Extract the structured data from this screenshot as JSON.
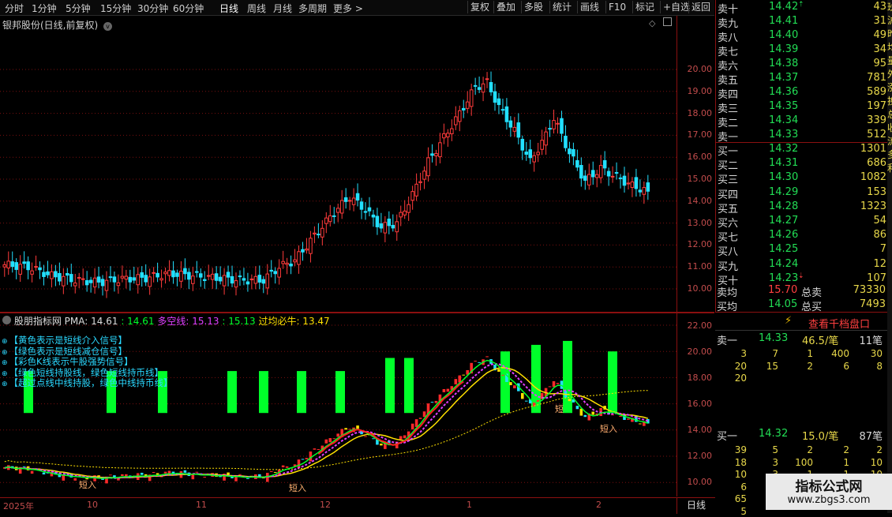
{
  "toolbar": {
    "periods": [
      "分时",
      "1分钟",
      "5分钟",
      "15分钟",
      "30分钟",
      "60分钟",
      "日线",
      "周线",
      "月线",
      "多周期",
      "更多 >"
    ],
    "active_period": "日线",
    "buttons": [
      "复权",
      "叠加",
      "多股",
      "统计",
      "画线",
      "F10",
      "标记",
      "+自选",
      "返回"
    ]
  },
  "stock": {
    "title": "银邦股份(日线,前复权)"
  },
  "price_axis": [
    "20.00",
    "19.00",
    "18.00",
    "17.00",
    "16.00",
    "15.00",
    "14.00",
    "13.00",
    "12.00",
    "11.00",
    "10.00"
  ],
  "indicator_axis": [
    "22.00",
    "20.00",
    "18.00",
    "16.00",
    "14.00",
    "12.00",
    "10.00"
  ],
  "indicator": {
    "name": "股朋指标网",
    "pma_label": "PMA: 14.61",
    "v1": ": 14.61",
    "duokong_label": "多空线: 15.13",
    "v2": ": 15.13",
    "guojun_label": "过均必牛: 13.47",
    "legend": [
      "【黄色表示是短线介入信号】",
      "【绿色表示是短线减仓信号】",
      "【彩色K线表示牛股强势信号】",
      "【绿色短线持股线，绿色短线持币线】",
      "【超过点线中线持股，绿色中线持币线】"
    ],
    "markers": [
      "短入",
      "短入",
      "短",
      "短入"
    ]
  },
  "time_axis": {
    "labels": [
      "2025年",
      "10",
      "11",
      "12",
      "1",
      "2"
    ],
    "period": "日线"
  },
  "order_book": {
    "sell": [
      {
        "label": "卖十",
        "price": "14.42",
        "vol": "43",
        "mark": "up"
      },
      {
        "label": "卖九",
        "price": "14.41",
        "vol": "31",
        "mark": ""
      },
      {
        "label": "卖八",
        "price": "14.40",
        "vol": "49",
        "mark": ""
      },
      {
        "label": "卖七",
        "price": "14.39",
        "vol": "34",
        "mark": ""
      },
      {
        "label": "卖六",
        "price": "14.38",
        "vol": "95",
        "mark": ""
      },
      {
        "label": "卖五",
        "price": "14.37",
        "vol": "781",
        "mark": ""
      },
      {
        "label": "卖四",
        "price": "14.36",
        "vol": "589",
        "mark": ""
      },
      {
        "label": "卖三",
        "price": "14.35",
        "vol": "197",
        "mark": ""
      },
      {
        "label": "卖二",
        "price": "14.34",
        "vol": "339",
        "mark": ""
      },
      {
        "label": "卖一",
        "price": "14.33",
        "vol": "512",
        "mark": ""
      }
    ],
    "buy": [
      {
        "label": "买一",
        "price": "14.32",
        "vol": "1301",
        "mark": ""
      },
      {
        "label": "买二",
        "price": "14.31",
        "vol": "686",
        "mark": ""
      },
      {
        "label": "买三",
        "price": "14.30",
        "vol": "1082",
        "mark": ""
      },
      {
        "label": "买四",
        "price": "14.29",
        "vol": "153",
        "mark": ""
      },
      {
        "label": "买五",
        "price": "14.28",
        "vol": "1323",
        "mark": ""
      },
      {
        "label": "买六",
        "price": "14.27",
        "vol": "54",
        "mark": ""
      },
      {
        "label": "买七",
        "price": "14.26",
        "vol": "86",
        "mark": ""
      },
      {
        "label": "买八",
        "price": "14.25",
        "vol": "7",
        "mark": ""
      },
      {
        "label": "买九",
        "price": "14.24",
        "vol": "12",
        "mark": ""
      },
      {
        "label": "买十",
        "price": "14.23",
        "vol": "107",
        "mark": "down"
      }
    ],
    "stats": [
      {
        "label": "卖均",
        "price": "15.70",
        "label2": "总卖",
        "vol": "73330"
      },
      {
        "label": "买均",
        "price": "14.05",
        "label2": "总买",
        "vol": "7493"
      }
    ],
    "up_arrow": "⇡",
    "down_arrow": "⇣"
  },
  "ten_levels_button": "查看千档盘口",
  "depth": {
    "sell_head": {
      "a": "卖一",
      "b": "14.33",
      "c": "46.5/笔",
      "d": "11笔"
    },
    "sell_grid": [
      [
        "3",
        "7",
        "1",
        "400",
        "30"
      ],
      [
        "20",
        "15",
        "2",
        "6",
        "8"
      ],
      [
        "20",
        "",
        "",
        "",
        ""
      ]
    ],
    "buy_head": {
      "a": "买一",
      "b": "14.32",
      "c": "15.0/笔",
      "d": "87笔"
    },
    "buy_grid": [
      [
        "39",
        "5",
        "2",
        "2",
        "2"
      ],
      [
        "18",
        "3",
        "100",
        "1",
        "10"
      ],
      [
        "10",
        "3",
        "1",
        "1",
        "10"
      ],
      [
        "6",
        "",
        "",
        "",
        ""
      ],
      [
        "65",
        "",
        "",
        "",
        ""
      ],
      [
        "5",
        "",
        "",
        "",
        ""
      ]
    ]
  },
  "right_strip": [
    "班",
    "沪",
    "昨",
    "均",
    "量",
    "外",
    "涨",
    "换",
    "总",
    "收",
    "流",
    "多",
    "利"
  ],
  "watermark": {
    "title": "指标公式网",
    "url": "www.zbgs3.com"
  },
  "colors": {
    "up": "#ff3b3b",
    "down": "#22e0ff",
    "signal_green": "#00ff2a",
    "yellow": "#ffe000",
    "magenta": "#e040ff"
  }
}
